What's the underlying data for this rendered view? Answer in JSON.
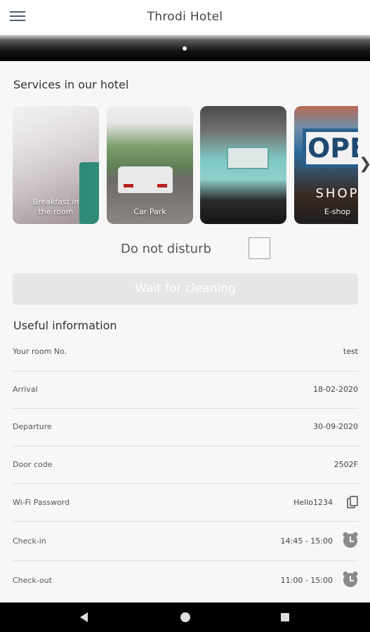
{
  "app": {
    "title": "Throdi Hotel"
  },
  "services": {
    "heading": "Services in our hotel",
    "cards": [
      {
        "caption": "Breakfast in the room"
      },
      {
        "caption": "Car Park"
      },
      {
        "caption": ""
      },
      {
        "caption": "E-shop",
        "sign_text": "OPE",
        "shop_text": "SHOP"
      }
    ]
  },
  "do_not_disturb": {
    "label": "Do not disturb",
    "checked": false
  },
  "wait_button": {
    "label": "Wait for cleaning"
  },
  "useful_info": {
    "heading": "Useful information",
    "rows": [
      {
        "label": "Your room No.",
        "value": "test"
      },
      {
        "label": "Arrival",
        "value": "18-02-2020"
      },
      {
        "label": "Departure",
        "value": "30-09-2020"
      },
      {
        "label": "Door code",
        "value": "2502F"
      },
      {
        "label": "Wi-Fi Password",
        "value": "Hello1234",
        "icon": "copy-icon"
      },
      {
        "label": "Check-in",
        "value": "14:45 - 15:00",
        "icon": "alarm-clock-icon"
      },
      {
        "label": "Check-out",
        "value": "11:00 - 15:00",
        "icon": "alarm-clock-icon"
      }
    ]
  },
  "colors": {
    "accent_dark": "#000000",
    "text": "#333333",
    "divider": "#dddddd",
    "icon_grey": "#8a8a8a"
  }
}
